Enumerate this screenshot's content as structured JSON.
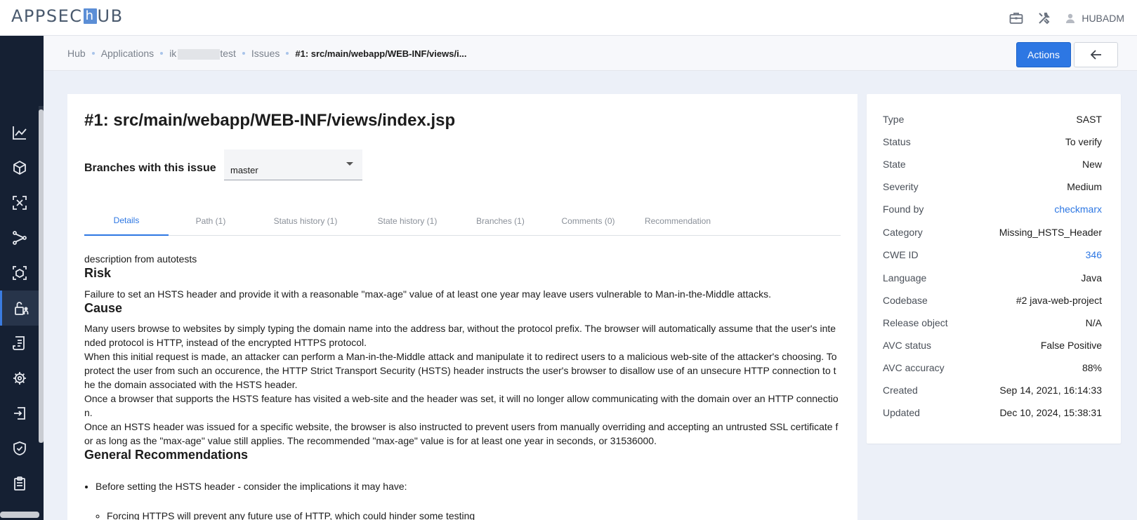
{
  "app": {
    "logo_left": "APPSEC",
    "logo_mark": "h",
    "logo_right": "UB",
    "username": "HUBADM"
  },
  "breadcrumb": {
    "items": [
      "Hub",
      "Applications",
      "ik",
      "test",
      "Issues"
    ],
    "current": "#1: src/main/webapp/WEB-INF/views/i..."
  },
  "toolbar": {
    "actions_label": "Actions"
  },
  "issue": {
    "title": "#1: src/main/webapp/WEB-INF/views/index.jsp",
    "branches_label": "Branches with this issue",
    "branch_selected": "master"
  },
  "tabs": [
    {
      "label": "Details"
    },
    {
      "label": "Path (1)"
    },
    {
      "label": "Status history (1)"
    },
    {
      "label": "State history (1)"
    },
    {
      "label": "Branches (1)"
    },
    {
      "label": "Comments (0)"
    },
    {
      "label": "Recommendation"
    }
  ],
  "details": {
    "lead": "description from autotests",
    "risk_heading": "Risk",
    "risk_text": "Failure to set an HSTS header and provide it with a reasonable \"max-age\" value of at least one year may leave users vulnerable to Man-in-the-Middle attacks.",
    "cause_heading": "Cause",
    "cause_p1": "Many users browse to websites by simply typing the domain name into the address bar, without the protocol prefix. The browser will automatically assume that the user's intended protocol is HTTP, instead of the encrypted HTTPS protocol.",
    "cause_p2": "When this initial request is made, an attacker can perform a Man-in-the-Middle attack and manipulate it to redirect users to a malicious web-site of the attacker's choosing. To protect the user from such an occurence, the HTTP Strict Transport Security (HSTS) header instructs the user's browser to disallow use of an unsecure HTTP connection to the the domain associated with the HSTS header.",
    "cause_p3": "Once a browser that supports the HSTS feature has visited a web-site and the header was set, it will no longer allow communicating with the domain over an HTTP connection.",
    "cause_p4": "Once an HSTS header was issued for a specific website, the browser is also instructed to prevent users from manually overriding and accepting an untrusted SSL certificate for as long as the \"max-age\" value still applies. The recommended \"max-age\" value is for at least one year in seconds, or 31536000.",
    "recommendations_heading": "General Recommendations",
    "rec_item_1": "Before setting the HSTS header - consider the implications it may have:",
    "rec_sub_1": "Forcing HTTPS will prevent any future use of HTTP, which could hinder some testing"
  },
  "info": {
    "rows": [
      {
        "key": "Type",
        "value": "SAST"
      },
      {
        "key": "Status",
        "value": "To verify"
      },
      {
        "key": "State",
        "value": "New"
      },
      {
        "key": "Severity",
        "value": "Medium"
      },
      {
        "key": "Found by",
        "value": "checkmarx"
      },
      {
        "key": "Category",
        "value": "Missing_HSTS_Header"
      },
      {
        "key": "CWE ID",
        "value": "346"
      },
      {
        "key": "Language",
        "value": "Java"
      },
      {
        "key": "Codebase",
        "value": "#2 java-web-project"
      },
      {
        "key": "Release object",
        "value": "N/A"
      },
      {
        "key": "AVC status",
        "value": "False Positive"
      },
      {
        "key": "AVC accuracy",
        "value": "88%"
      },
      {
        "key": "Created",
        "value": "Sep 14, 2021, 16:14:33"
      },
      {
        "key": "Updated",
        "value": "Dec 10, 2024, 15:38:31"
      }
    ]
  },
  "sidebar": {
    "icons": [
      "chart-line-icon",
      "box-icon",
      "scan-icon",
      "branch-icon",
      "cube-scan-icon",
      "lock-user-icon",
      "report-icon",
      "bug-gear-icon",
      "exit-icon",
      "shield-check-icon",
      "clipboard-icon"
    ]
  },
  "colors": {
    "accent": "#2d77e3",
    "sidebar_bg": "#152033",
    "page_bg": "#ecf0f8"
  }
}
